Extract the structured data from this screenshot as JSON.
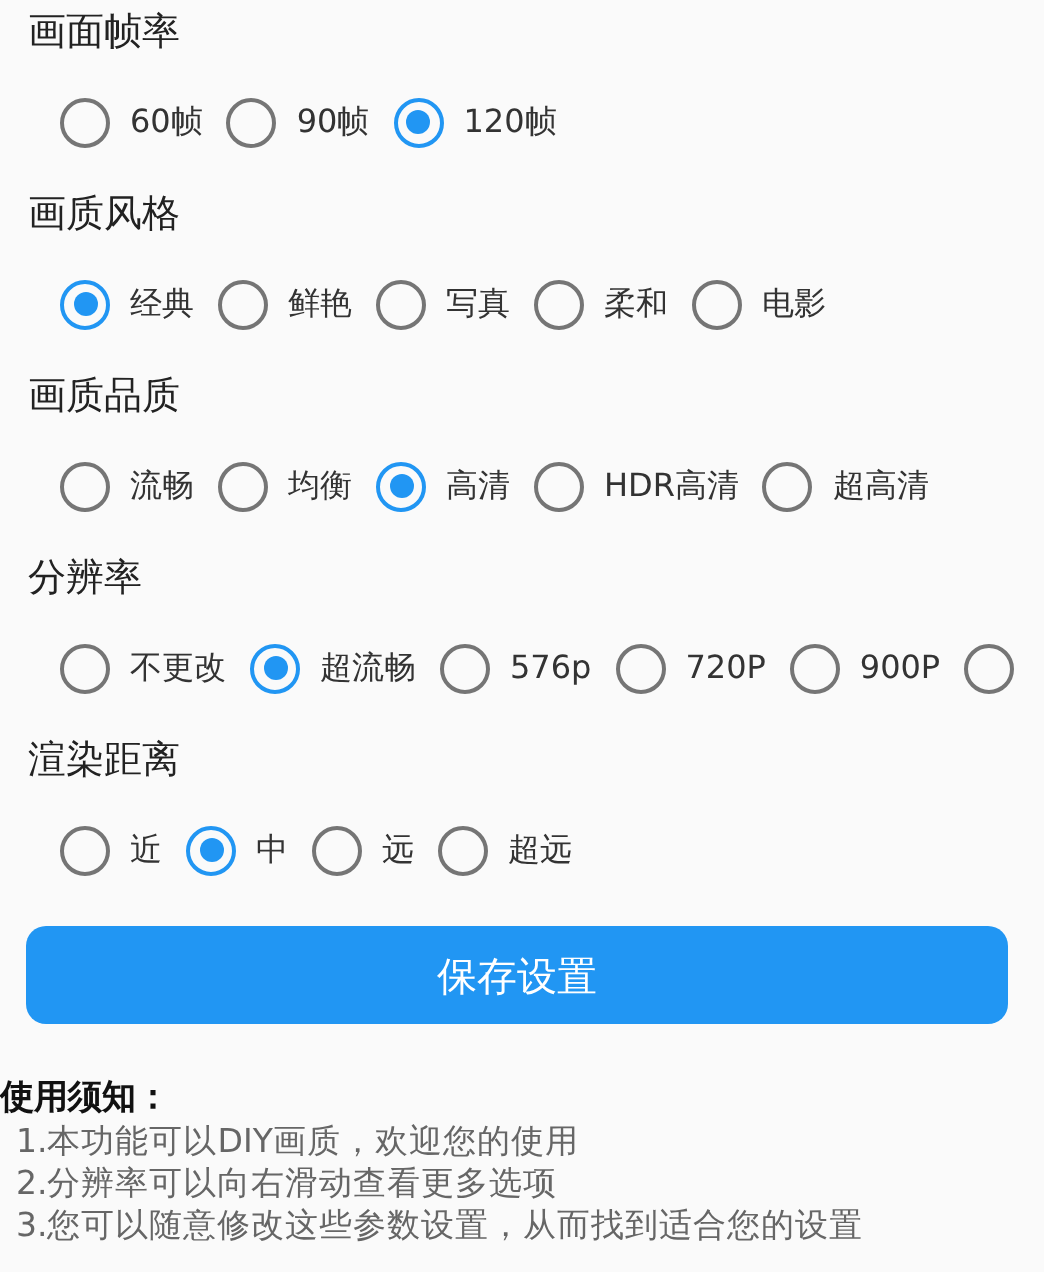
{
  "sections": [
    {
      "title": "画面帧率",
      "options": [
        {
          "label": "60帧",
          "selected": false
        },
        {
          "label": "90帧",
          "selected": false
        },
        {
          "label": "120帧",
          "selected": true
        }
      ]
    },
    {
      "title": "画质风格",
      "options": [
        {
          "label": "经典",
          "selected": true
        },
        {
          "label": "鲜艳",
          "selected": false
        },
        {
          "label": "写真",
          "selected": false
        },
        {
          "label": "柔和",
          "selected": false
        },
        {
          "label": "电影",
          "selected": false
        }
      ]
    },
    {
      "title": "画质品质",
      "options": [
        {
          "label": "流畅",
          "selected": false
        },
        {
          "label": "均衡",
          "selected": false
        },
        {
          "label": "高清",
          "selected": true
        },
        {
          "label": "HDR高清",
          "selected": false
        },
        {
          "label": "超高清",
          "selected": false
        }
      ]
    },
    {
      "title": "分辨率",
      "options": [
        {
          "label": "不更改",
          "selected": false
        },
        {
          "label": "超流畅",
          "selected": true
        },
        {
          "label": "576p",
          "selected": false
        },
        {
          "label": "720P",
          "selected": false
        },
        {
          "label": "900P",
          "selected": false
        },
        {
          "selected": false
        }
      ]
    },
    {
      "title": "渲染距离",
      "options": [
        {
          "label": "近",
          "selected": false
        },
        {
          "label": "中",
          "selected": true
        },
        {
          "label": "远",
          "selected": false
        },
        {
          "label": "超远",
          "selected": false
        }
      ]
    }
  ],
  "save_button": "保存设置",
  "notes": {
    "title": "使用须知：",
    "lines": [
      "1.本功能可以DIY画质，欢迎您的使用",
      "2.分辨率可以向右滑动查看更多选项",
      "3.您可以随意修改这些参数设置，从而找到适合您的设置"
    ]
  }
}
